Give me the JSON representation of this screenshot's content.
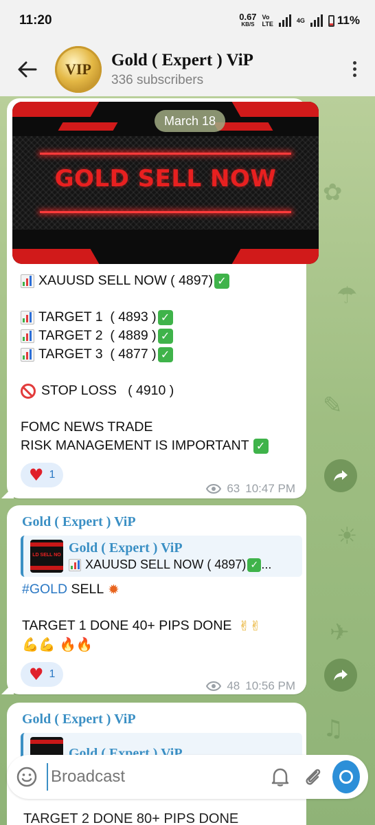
{
  "status_bar": {
    "time": "11:20",
    "net_speed": "0.67",
    "net_unit": "KB/S",
    "volte_top": "Vo",
    "volte_bottom": "LTE",
    "network_type": "4G",
    "battery": "11%"
  },
  "header": {
    "avatar_text": "VIP",
    "title": "Gold ( Expert ) ViP",
    "subtitle": "336 subscribers"
  },
  "message1": {
    "date_pill": "March 18",
    "banner_text": "GOLD SELL NOW",
    "line1": "XAUUSD SELL NOW ( 4897)",
    "target1": "TARGET 1  ( 4893 )",
    "target2": "TARGET 2  ( 4889 )",
    "target3": "TARGET 3  ( 4877 )",
    "stop_loss": "STOP LOSS   ( 4910 )",
    "note1": "FOMC NEWS TRADE",
    "note2": "RISK MANAGEMENT IS IMPORTANT",
    "reaction_count": "1",
    "views": "63",
    "time": "10:47 PM"
  },
  "message2": {
    "author": "Gold ( Expert ) ViP",
    "reply_author": "Gold ( Expert ) ViP",
    "reply_thumb_text": "LD SELL NO",
    "reply_text": "XAUUSD SELL NOW ( 4897)",
    "reply_ellipsis": "...",
    "hashtag": "#GOLD",
    "sell_word": " SELL",
    "done_line": "TARGET 1 DONE 40+ PIPS DONE",
    "reaction_count": "1",
    "views": "48",
    "time": "10:56 PM"
  },
  "message3": {
    "author": "Gold ( Expert ) ViP",
    "reply_author": "Gold ( Expert ) ViP",
    "peek_text": "TARGET 2 DONE 80+ PIPS DONE"
  },
  "input": {
    "placeholder": "Broadcast"
  },
  "icons": {
    "back": "arrow-left",
    "more": "more-vertical",
    "share": "share-arrow",
    "emoji": "smiley",
    "bell": "bell",
    "attach": "paperclip",
    "camera": "camera"
  },
  "colors": {
    "accent": "#3a8fc4",
    "reaction_bg": "#e3eefb",
    "heart": "#e0202a",
    "check": "#3fb34a",
    "banner_red": "#d11a1a"
  }
}
